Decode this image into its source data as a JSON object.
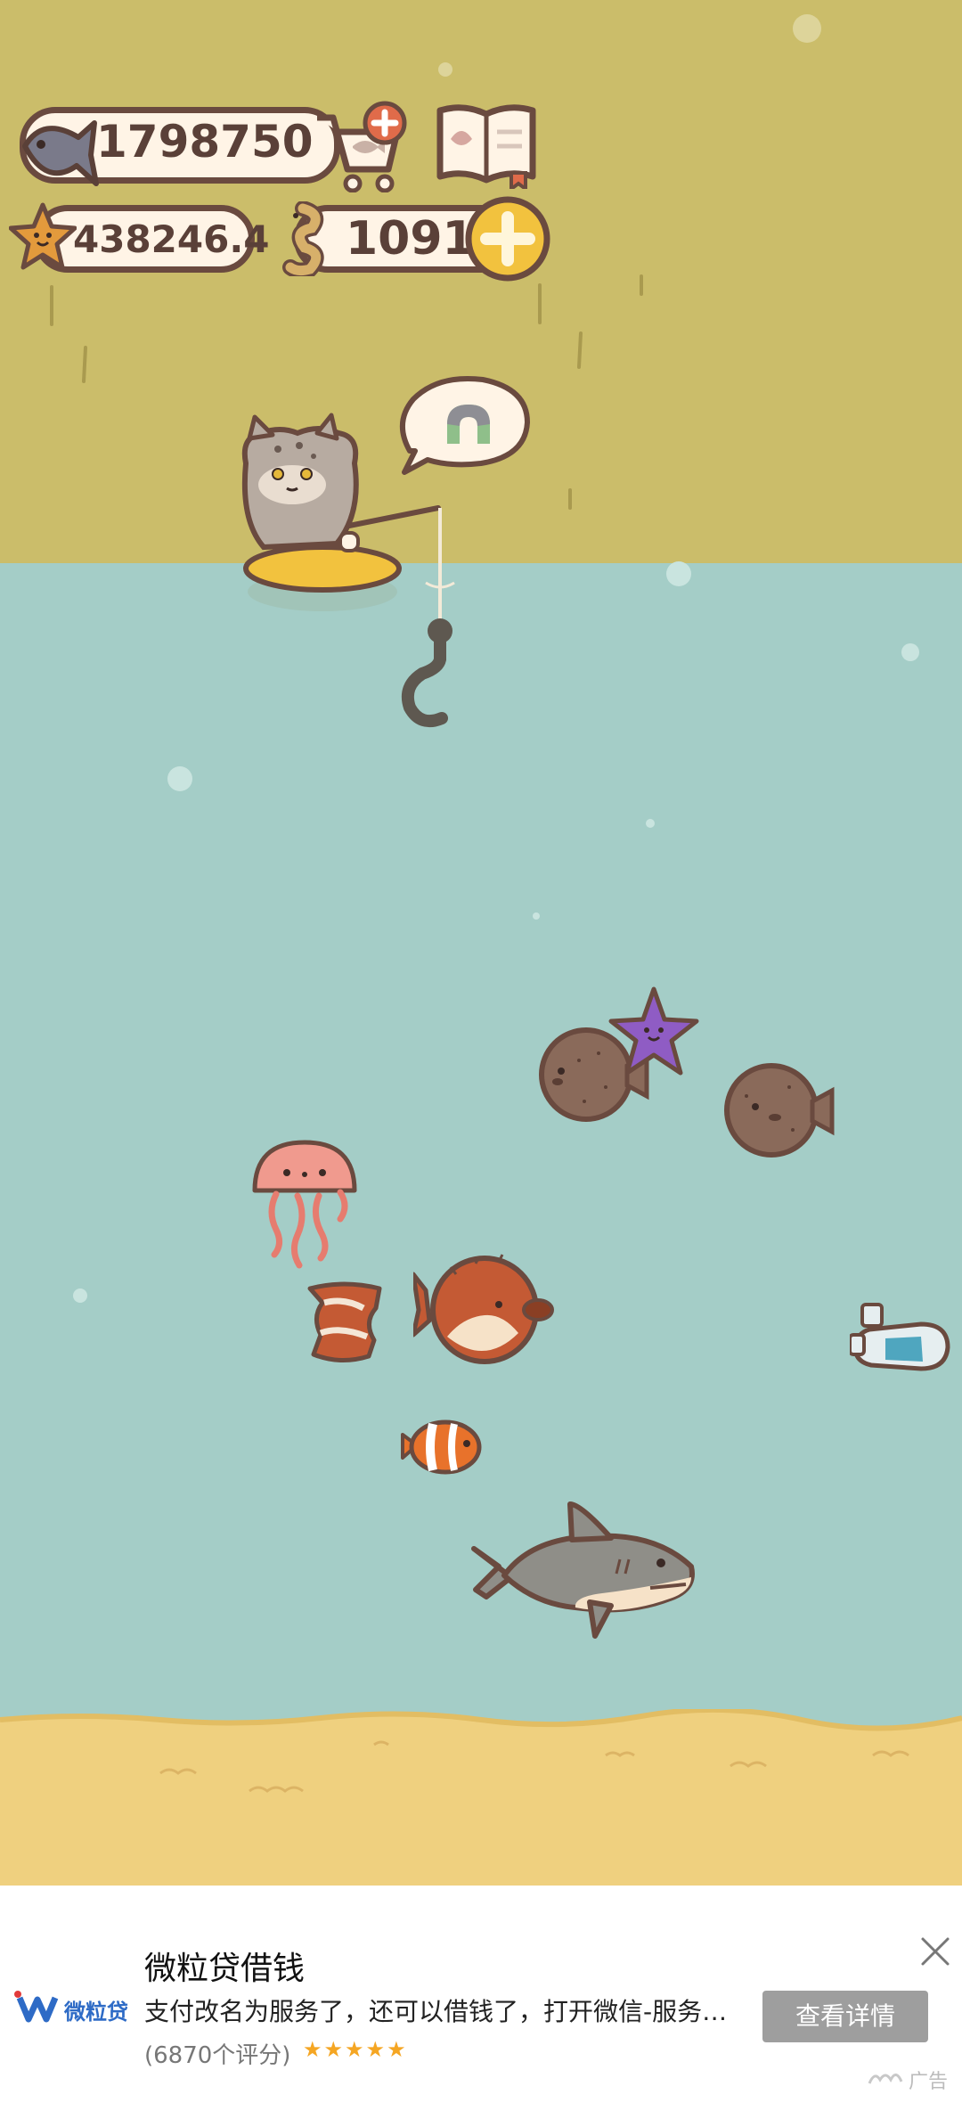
{
  "hud": {
    "fish_count": "1798750",
    "star_count": "438246.4",
    "worm_count": "1091"
  },
  "ad": {
    "title": "微粒贷借钱",
    "description": "支付改名为服务了，还可以借钱了，打开微信-服务-微粒贷借钱",
    "rating": "(6870个评分)",
    "stars": "★★★★★",
    "button": "查看详情",
    "label": "广告",
    "brand": "微粒贷"
  },
  "colors": {
    "sky": "#cbbd6a",
    "sea": "#a4cdc7",
    "sand": "#efd07f",
    "outline": "#6a4a3f"
  }
}
